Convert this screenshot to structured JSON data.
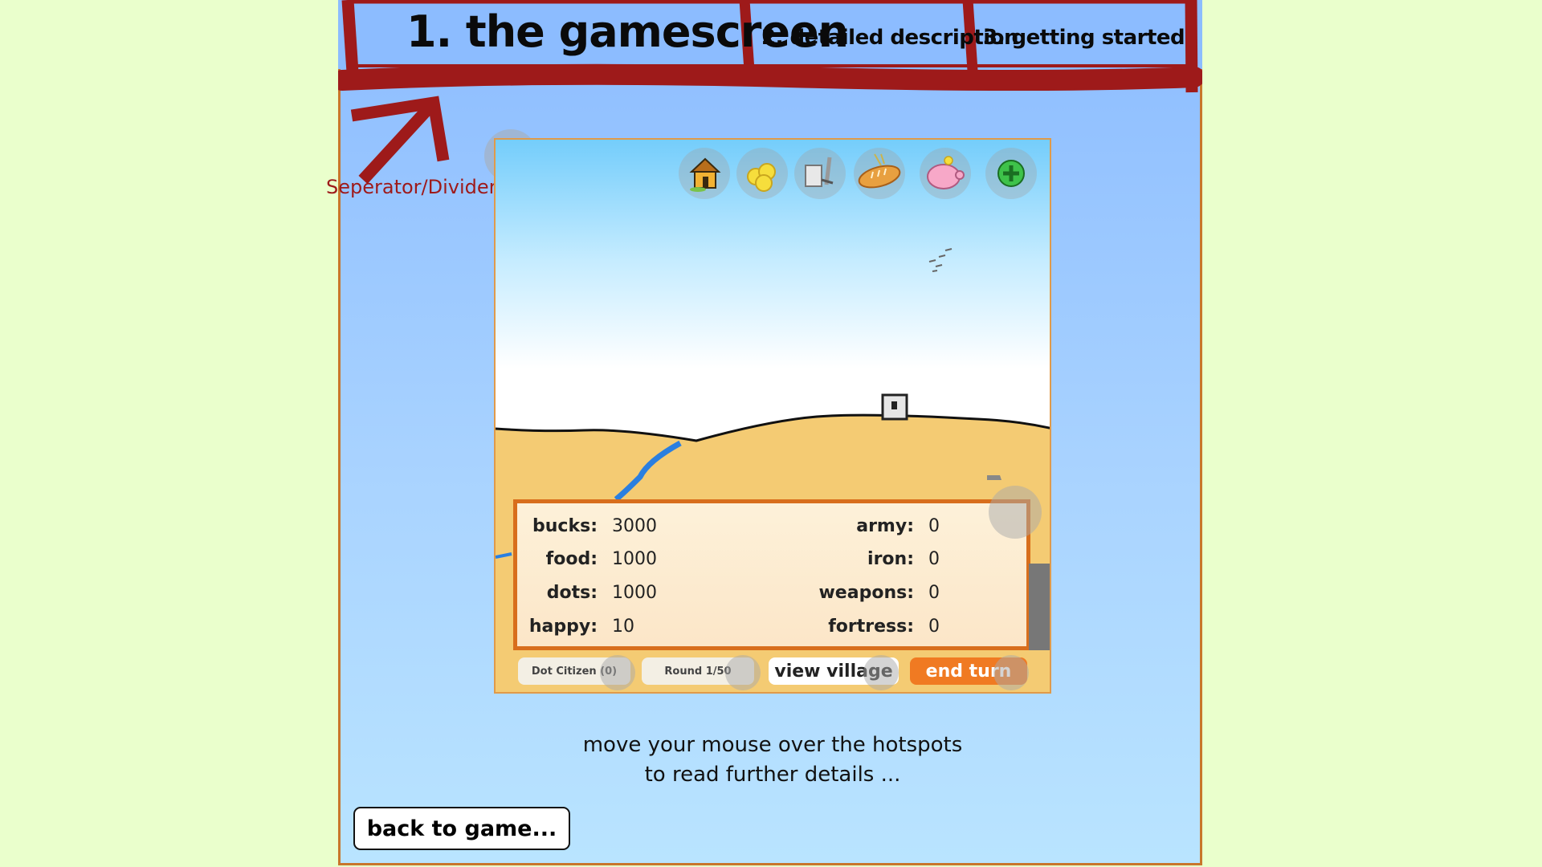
{
  "tabs": [
    {
      "label": "1. the gamescreen",
      "active": true
    },
    {
      "label": "2. detailed description",
      "active": false
    },
    {
      "label": "3. getting started",
      "active": false
    }
  ],
  "annotation": {
    "label": "Seperator/Divider"
  },
  "game": {
    "toolbar_icons": [
      "house-icon",
      "coins-icon",
      "weapons-icon",
      "bread-icon",
      "piggy-bank-icon",
      "plus-icon"
    ],
    "stats_left": [
      {
        "label": "bucks:",
        "value": "3000"
      },
      {
        "label": "food:",
        "value": "1000"
      },
      {
        "label": "dots:",
        "value": "1000"
      },
      {
        "label": "happy:",
        "value": "10"
      }
    ],
    "stats_right": [
      {
        "label": "army:",
        "value": "0"
      },
      {
        "label": "iron:",
        "value": "0"
      },
      {
        "label": "weapons:",
        "value": "0"
      },
      {
        "label": "fortress:",
        "value": "0"
      }
    ],
    "bottom_bar": {
      "citizen": "Dot Citizen (0)",
      "round": "Round 1/50",
      "view_village": "view village",
      "end_turn": "end turn"
    }
  },
  "instructions": {
    "line1": "move your mouse over the hotspots",
    "line2": "to read further details ..."
  },
  "back_button": "back to game...",
  "colors": {
    "page_bg": "#eaffcc",
    "tab_border": "#9e1a1a",
    "panel_border": "#c8762c",
    "end_turn": "#f07a22"
  }
}
